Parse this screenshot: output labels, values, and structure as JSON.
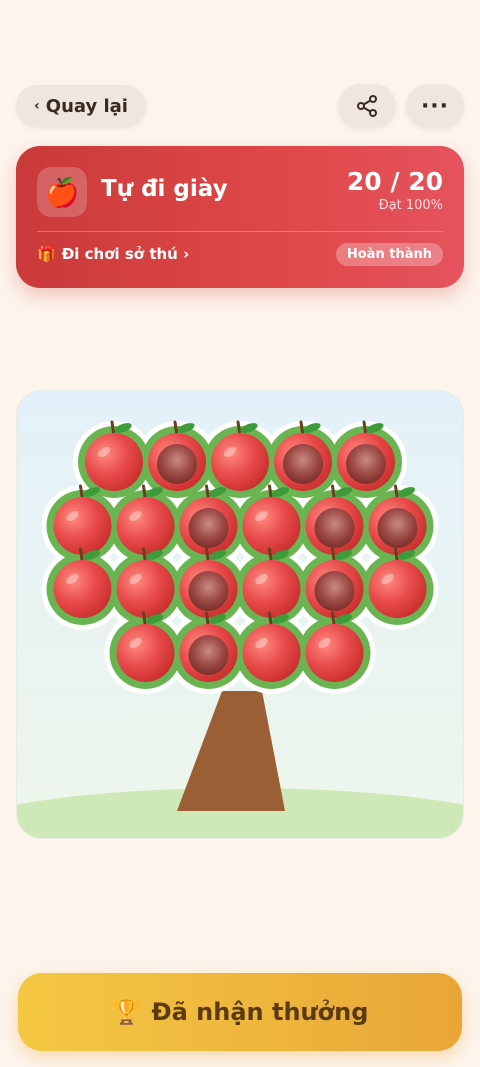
{
  "header": {
    "back_label": "Quay lại",
    "back_icon": "‹",
    "more_icon": "···"
  },
  "goal": {
    "icon": "🍎",
    "title": "Tự đi giày",
    "progress_text": "20 / 20",
    "percent_text": "Đạt 100%",
    "reward_icon": "🎁",
    "reward_label": "Đi chơi sở thú ›",
    "status_badge": "Hoàn thành"
  },
  "tree": {
    "total": 20,
    "rows": [
      [
        "filled",
        "empty",
        "filled",
        "empty",
        "empty"
      ],
      [
        "filled",
        "filled",
        "empty",
        "filled",
        "empty",
        "empty"
      ],
      [
        "filled",
        "filled",
        "empty",
        "filled",
        "empty",
        "filled"
      ],
      [
        "filled",
        "empty",
        "filled",
        "filled"
      ]
    ]
  },
  "claim_button": {
    "icon": "🏆",
    "label": "Đã nhận thưởng"
  },
  "colors": {
    "card": "#e04848",
    "leaf": "#6ab552",
    "trunk": "#9b5f36",
    "apple": "#e04848",
    "button": "#f0b83e"
  }
}
